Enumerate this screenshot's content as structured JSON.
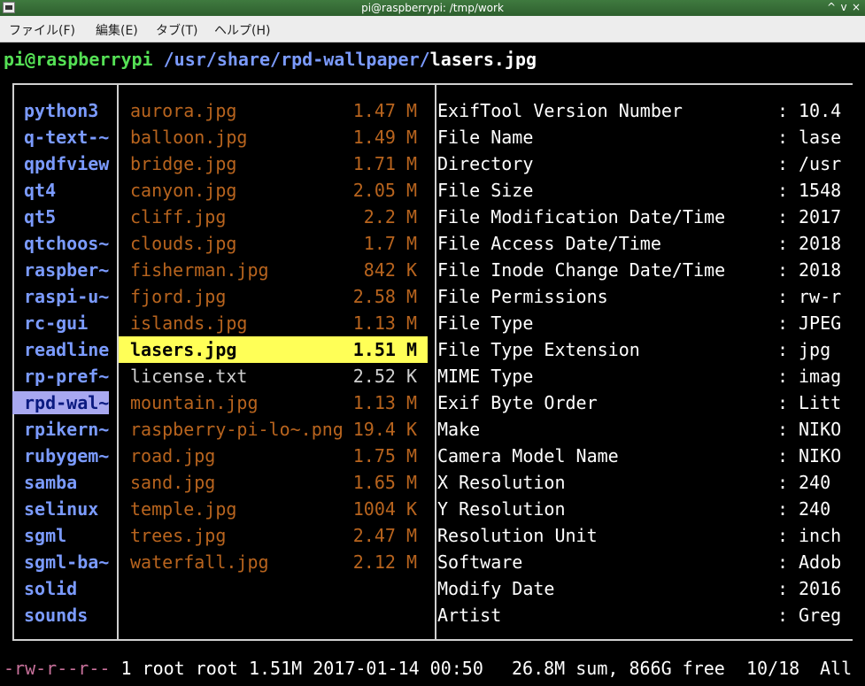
{
  "window": {
    "title": "pi@raspberrypi: /tmp/work"
  },
  "window_buttons": [
    "^",
    "v",
    "×"
  ],
  "menu": [
    "ファイル(F)",
    "編集(E)",
    "タブ(T)",
    "ヘルプ(H)"
  ],
  "prompt": {
    "user_host": "pi@raspberrypi",
    "path": " /usr/share/rpd-wallpaper/",
    "file": "lasers.jpg"
  },
  "parent_dirs": [
    "python3",
    "q-text-~",
    "qpdfview",
    "qt4",
    "qt5",
    "qtchoos~",
    "raspber~",
    "raspi-u~",
    "rc-gui",
    "readline",
    "rp-pref~",
    "rpd-wal~",
    "rpikern~",
    "rubygem~",
    "samba",
    "selinux",
    "sgml",
    "sgml-ba~",
    "solid",
    "sounds"
  ],
  "parent_selected": "rpd-wal~",
  "files": [
    {
      "name": "aurora.jpg",
      "size": "1.47 M"
    },
    {
      "name": "balloon.jpg",
      "size": "1.49 M"
    },
    {
      "name": "bridge.jpg",
      "size": "1.71 M"
    },
    {
      "name": "canyon.jpg",
      "size": "2.05 M"
    },
    {
      "name": "cliff.jpg",
      "size": "2.2 M"
    },
    {
      "name": "clouds.jpg",
      "size": "1.7 M"
    },
    {
      "name": "fisherman.jpg",
      "size": "842 K"
    },
    {
      "name": "fjord.jpg",
      "size": "2.58 M"
    },
    {
      "name": "islands.jpg",
      "size": "1.13 M"
    },
    {
      "name": "lasers.jpg",
      "size": "1.51 M",
      "selected": true
    },
    {
      "name": "license.txt",
      "size": "2.52 K",
      "plain": true
    },
    {
      "name": "mountain.jpg",
      "size": "1.13 M"
    },
    {
      "name": "raspberry-pi-lo~.png",
      "size": "19.4 K"
    },
    {
      "name": "road.jpg",
      "size": "1.75 M"
    },
    {
      "name": "sand.jpg",
      "size": "1.65 M"
    },
    {
      "name": "temple.jpg",
      "size": "1004 K"
    },
    {
      "name": "trees.jpg",
      "size": "2.47 M"
    },
    {
      "name": "waterfall.jpg",
      "size": "2.12 M"
    }
  ],
  "preview": [
    {
      "key": "ExifTool Version Number",
      "value": "10.4"
    },
    {
      "key": "File Name",
      "value": "lase"
    },
    {
      "key": "Directory",
      "value": "/usr"
    },
    {
      "key": "File Size",
      "value": "1548"
    },
    {
      "key": "File Modification Date/Time",
      "value": "2017"
    },
    {
      "key": "File Access Date/Time",
      "value": "2018"
    },
    {
      "key": "File Inode Change Date/Time",
      "value": "2018"
    },
    {
      "key": "File Permissions",
      "value": "rw-r"
    },
    {
      "key": "File Type",
      "value": "JPEG"
    },
    {
      "key": "File Type Extension",
      "value": "jpg"
    },
    {
      "key": "MIME Type",
      "value": "imag"
    },
    {
      "key": "Exif Byte Order",
      "value": "Litt"
    },
    {
      "key": "Make",
      "value": "NIKO"
    },
    {
      "key": "Camera Model Name",
      "value": "NIKO"
    },
    {
      "key": "X Resolution",
      "value": "240"
    },
    {
      "key": "Y Resolution",
      "value": "240"
    },
    {
      "key": "Resolution Unit",
      "value": "inch"
    },
    {
      "key": "Software",
      "value": "Adob"
    },
    {
      "key": "Modify Date",
      "value": "2016"
    },
    {
      "key": "Artist",
      "value": "Greg"
    }
  ],
  "status": {
    "perms": "-rw-r--r--",
    "info": " 1 root root 1.51M 2017-01-14 00:50",
    "disk": "26.8M sum, 866G free",
    "position": "10/18",
    "scroll": "All"
  },
  "colors": {
    "titlebar": "#2e5f2e",
    "prompt_user": "#55e055",
    "directory": "#7b9bff",
    "image_file": "#b8641e",
    "selection": "#ffff57",
    "perms": "#c8719b"
  }
}
